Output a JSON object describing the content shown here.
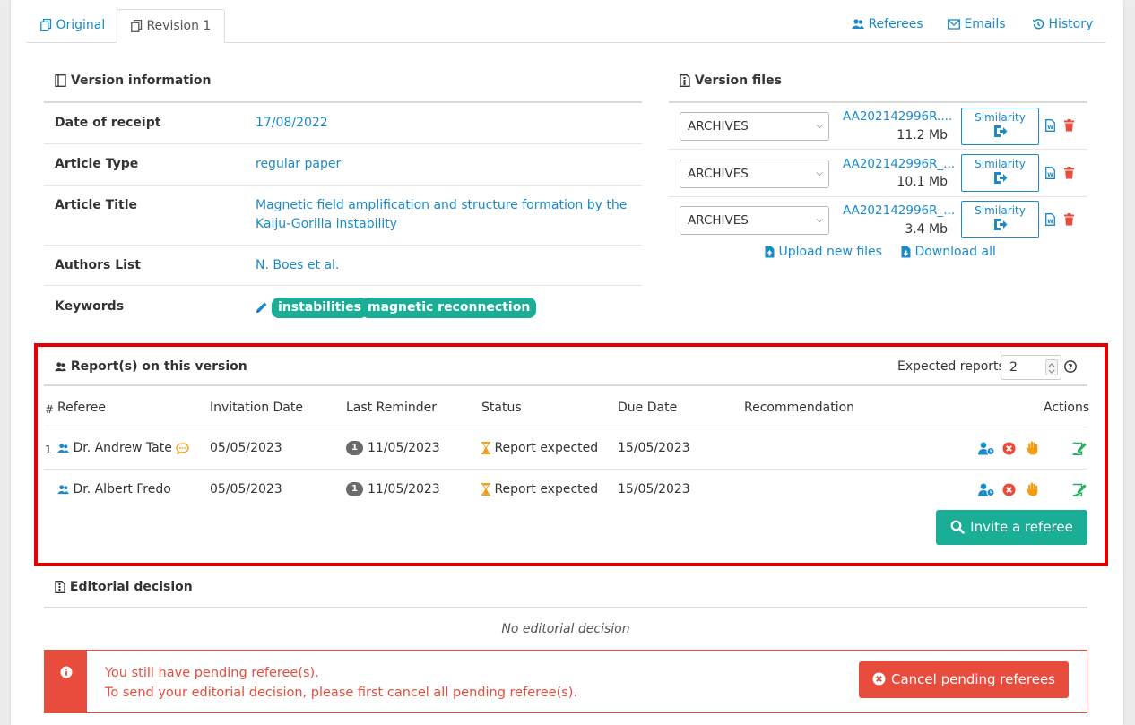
{
  "tabs": {
    "original": "Original",
    "revision": "Revision 1",
    "referees": "Referees",
    "emails": "Emails",
    "history": "History"
  },
  "version_info": {
    "title": "Version information",
    "rows": [
      {
        "label": "Date of receipt",
        "value": "17/08/2022"
      },
      {
        "label": "Article Type",
        "value": "regular paper"
      },
      {
        "label": "Article Title",
        "value": "Magnetic field amplification and structure formation by the Kaiju-Gorilla instability"
      },
      {
        "label": "Authors List",
        "value": "N. Boes et al."
      },
      {
        "label": "Keywords",
        "value": ""
      }
    ],
    "keywords": [
      "instabilities",
      "magnetic reconnection"
    ]
  },
  "version_files": {
    "title": "Version files",
    "files": [
      {
        "type": "ARCHIVES",
        "name": "AA202142996R....",
        "size": "11.2 Mb",
        "similarity": "Similarity"
      },
      {
        "type": "ARCHIVES",
        "name": "AA202142996R_...",
        "size": "10.1 Mb",
        "similarity": "Similarity"
      },
      {
        "type": "ARCHIVES",
        "name": "AA202142996R_...",
        "size": "3.4 Mb",
        "similarity": "Similarity"
      }
    ],
    "upload": "Upload new files",
    "download": "Download all"
  },
  "reports": {
    "title": "Report(s) on this version",
    "expected_label": "Expected reports",
    "expected_value": "2",
    "columns": [
      "#",
      "Referee",
      "Invitation Date",
      "Last Reminder",
      "Status",
      "Due Date",
      "Recommendation",
      "Actions"
    ],
    "rows": [
      {
        "num": "1",
        "referee": "Dr. Andrew Tate",
        "invitation": "05/05/2023",
        "reminder_count": "1",
        "reminder": "11/05/2023",
        "status": "Report expected",
        "due": "15/05/2023",
        "recommendation": ""
      },
      {
        "num": "",
        "referee": "Dr. Albert Fredo",
        "invitation": "05/05/2023",
        "reminder_count": "1",
        "reminder": "11/05/2023",
        "status": "Report expected",
        "due": "15/05/2023",
        "recommendation": ""
      }
    ],
    "invite_button": "Invite a referee"
  },
  "editorial": {
    "title": "Editorial decision",
    "empty": "No editorial decision"
  },
  "alert": {
    "line1": "You still have pending referee(s).",
    "line2": "To send your editorial decision, please first cancel all pending referee(s).",
    "button": "Cancel pending referees"
  },
  "colors": {
    "link": "#1a8ac9",
    "teal": "#1bae96",
    "danger": "#e74c3c",
    "highlight": "#e30000",
    "orange": "#f39c12"
  }
}
